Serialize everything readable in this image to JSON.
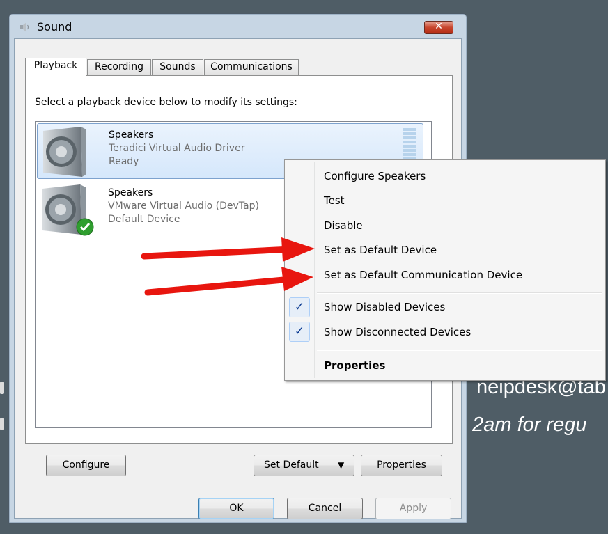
{
  "background": {
    "email_fragment": "neipdesk@tab",
    "note_fragment": ": 2am for regu"
  },
  "window": {
    "title": "Sound",
    "close_glyph": "✕"
  },
  "tabs": [
    {
      "label": "Playback",
      "active": true
    },
    {
      "label": "Recording",
      "active": false
    },
    {
      "label": "Sounds",
      "active": false
    },
    {
      "label": "Communications",
      "active": false
    }
  ],
  "panel": {
    "instruction": "Select a playback device below to modify its settings:"
  },
  "devices": [
    {
      "name": "Speakers",
      "driver": "Teradici Virtual Audio Driver",
      "status": "Ready",
      "selected": true
    },
    {
      "name": "Speakers",
      "driver": "VMware Virtual Audio (DevTap)",
      "status": "Default Device",
      "selected": false,
      "default_badge": "green-check-icon"
    }
  ],
  "buttons": {
    "configure": "Configure",
    "set_default": "Set Default",
    "set_default_arrow": "▼",
    "properties": "Properties",
    "ok": "OK",
    "cancel": "Cancel",
    "apply": "Apply"
  },
  "context_menu": {
    "items": [
      {
        "label": "Configure Speakers"
      },
      {
        "label": "Test"
      },
      {
        "label": "Disable"
      },
      {
        "label": "Set as Default Device"
      },
      {
        "label": "Set as Default Communication Device"
      },
      {
        "label": "Show Disabled Devices",
        "checked": true
      },
      {
        "label": "Show Disconnected Devices",
        "checked": true
      },
      {
        "label": "Properties",
        "bold": true
      }
    ],
    "check_glyph": "✓"
  },
  "colors": {
    "desktop": "#4f5d66",
    "annotation_arrow": "#e8160f",
    "selection": "#d5e7fb"
  }
}
